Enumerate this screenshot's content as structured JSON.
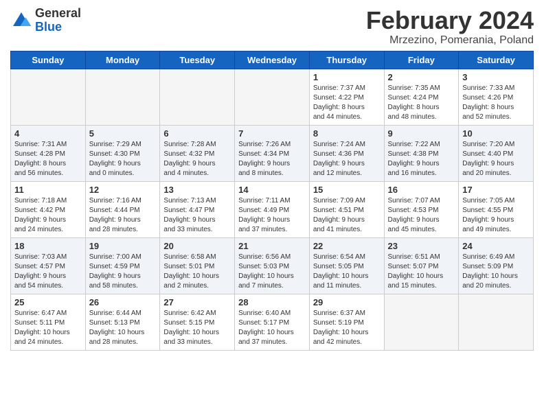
{
  "header": {
    "logo_text_general": "General",
    "logo_text_blue": "Blue",
    "month_title": "February 2024",
    "subtitle": "Mrzezino, Pomerania, Poland"
  },
  "days_of_week": [
    "Sunday",
    "Monday",
    "Tuesday",
    "Wednesday",
    "Thursday",
    "Friday",
    "Saturday"
  ],
  "weeks": [
    {
      "shade": false,
      "days": [
        {
          "num": "",
          "info": ""
        },
        {
          "num": "",
          "info": ""
        },
        {
          "num": "",
          "info": ""
        },
        {
          "num": "",
          "info": ""
        },
        {
          "num": "1",
          "info": "Sunrise: 7:37 AM\nSunset: 4:22 PM\nDaylight: 8 hours\nand 44 minutes."
        },
        {
          "num": "2",
          "info": "Sunrise: 7:35 AM\nSunset: 4:24 PM\nDaylight: 8 hours\nand 48 minutes."
        },
        {
          "num": "3",
          "info": "Sunrise: 7:33 AM\nSunset: 4:26 PM\nDaylight: 8 hours\nand 52 minutes."
        }
      ]
    },
    {
      "shade": true,
      "days": [
        {
          "num": "4",
          "info": "Sunrise: 7:31 AM\nSunset: 4:28 PM\nDaylight: 8 hours\nand 56 minutes."
        },
        {
          "num": "5",
          "info": "Sunrise: 7:29 AM\nSunset: 4:30 PM\nDaylight: 9 hours\nand 0 minutes."
        },
        {
          "num": "6",
          "info": "Sunrise: 7:28 AM\nSunset: 4:32 PM\nDaylight: 9 hours\nand 4 minutes."
        },
        {
          "num": "7",
          "info": "Sunrise: 7:26 AM\nSunset: 4:34 PM\nDaylight: 9 hours\nand 8 minutes."
        },
        {
          "num": "8",
          "info": "Sunrise: 7:24 AM\nSunset: 4:36 PM\nDaylight: 9 hours\nand 12 minutes."
        },
        {
          "num": "9",
          "info": "Sunrise: 7:22 AM\nSunset: 4:38 PM\nDaylight: 9 hours\nand 16 minutes."
        },
        {
          "num": "10",
          "info": "Sunrise: 7:20 AM\nSunset: 4:40 PM\nDaylight: 9 hours\nand 20 minutes."
        }
      ]
    },
    {
      "shade": false,
      "days": [
        {
          "num": "11",
          "info": "Sunrise: 7:18 AM\nSunset: 4:42 PM\nDaylight: 9 hours\nand 24 minutes."
        },
        {
          "num": "12",
          "info": "Sunrise: 7:16 AM\nSunset: 4:44 PM\nDaylight: 9 hours\nand 28 minutes."
        },
        {
          "num": "13",
          "info": "Sunrise: 7:13 AM\nSunset: 4:47 PM\nDaylight: 9 hours\nand 33 minutes."
        },
        {
          "num": "14",
          "info": "Sunrise: 7:11 AM\nSunset: 4:49 PM\nDaylight: 9 hours\nand 37 minutes."
        },
        {
          "num": "15",
          "info": "Sunrise: 7:09 AM\nSunset: 4:51 PM\nDaylight: 9 hours\nand 41 minutes."
        },
        {
          "num": "16",
          "info": "Sunrise: 7:07 AM\nSunset: 4:53 PM\nDaylight: 9 hours\nand 45 minutes."
        },
        {
          "num": "17",
          "info": "Sunrise: 7:05 AM\nSunset: 4:55 PM\nDaylight: 9 hours\nand 49 minutes."
        }
      ]
    },
    {
      "shade": true,
      "days": [
        {
          "num": "18",
          "info": "Sunrise: 7:03 AM\nSunset: 4:57 PM\nDaylight: 9 hours\nand 54 minutes."
        },
        {
          "num": "19",
          "info": "Sunrise: 7:00 AM\nSunset: 4:59 PM\nDaylight: 9 hours\nand 58 minutes."
        },
        {
          "num": "20",
          "info": "Sunrise: 6:58 AM\nSunset: 5:01 PM\nDaylight: 10 hours\nand 2 minutes."
        },
        {
          "num": "21",
          "info": "Sunrise: 6:56 AM\nSunset: 5:03 PM\nDaylight: 10 hours\nand 7 minutes."
        },
        {
          "num": "22",
          "info": "Sunrise: 6:54 AM\nSunset: 5:05 PM\nDaylight: 10 hours\nand 11 minutes."
        },
        {
          "num": "23",
          "info": "Sunrise: 6:51 AM\nSunset: 5:07 PM\nDaylight: 10 hours\nand 15 minutes."
        },
        {
          "num": "24",
          "info": "Sunrise: 6:49 AM\nSunset: 5:09 PM\nDaylight: 10 hours\nand 20 minutes."
        }
      ]
    },
    {
      "shade": false,
      "days": [
        {
          "num": "25",
          "info": "Sunrise: 6:47 AM\nSunset: 5:11 PM\nDaylight: 10 hours\nand 24 minutes."
        },
        {
          "num": "26",
          "info": "Sunrise: 6:44 AM\nSunset: 5:13 PM\nDaylight: 10 hours\nand 28 minutes."
        },
        {
          "num": "27",
          "info": "Sunrise: 6:42 AM\nSunset: 5:15 PM\nDaylight: 10 hours\nand 33 minutes."
        },
        {
          "num": "28",
          "info": "Sunrise: 6:40 AM\nSunset: 5:17 PM\nDaylight: 10 hours\nand 37 minutes."
        },
        {
          "num": "29",
          "info": "Sunrise: 6:37 AM\nSunset: 5:19 PM\nDaylight: 10 hours\nand 42 minutes."
        },
        {
          "num": "",
          "info": ""
        },
        {
          "num": "",
          "info": ""
        }
      ]
    }
  ]
}
